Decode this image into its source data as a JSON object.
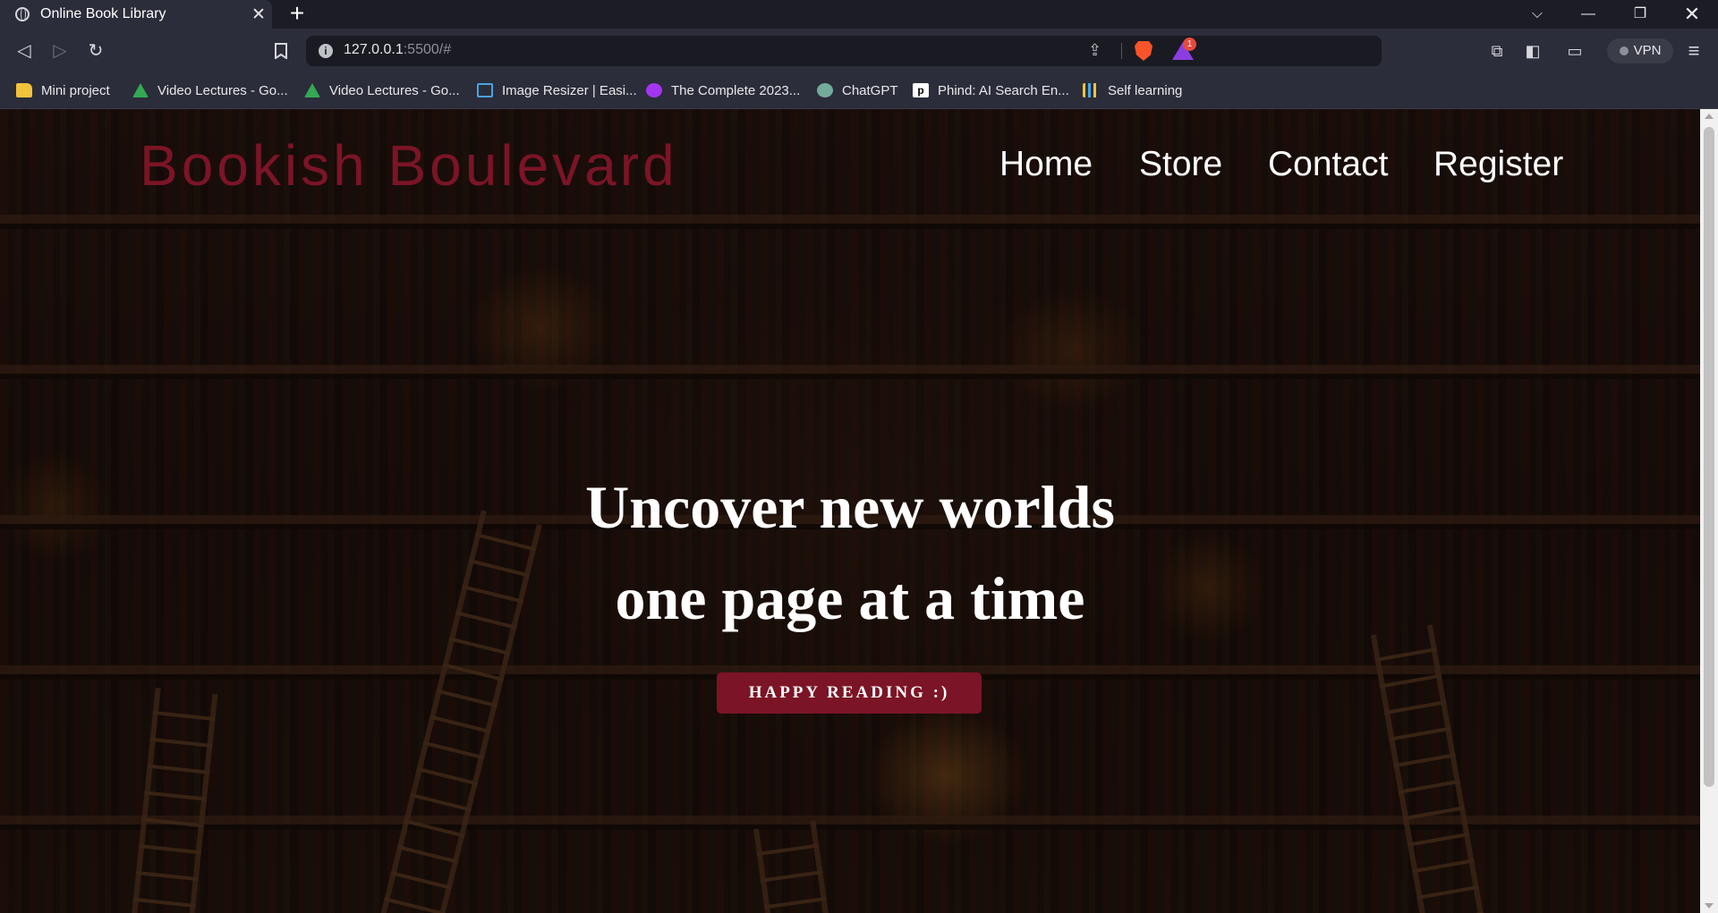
{
  "browser": {
    "tab": {
      "title": "Online Book Library",
      "close_icon": "✕"
    },
    "new_tab_icon": "+",
    "window_controls": {
      "tab_search": "⌵",
      "minimize": "—",
      "maximize": "❐",
      "close": "✕"
    },
    "toolbar": {
      "back_icon": "◁",
      "forward_icon": "▷",
      "reload_icon": "↻",
      "bookmark_icon": "🔖",
      "url_host": "127.0.0.1",
      "url_rest": ":5500/#",
      "share_icon": "⇪",
      "rewards_badge": "1",
      "extensions_icon": "⧉",
      "sidebar_icon": "◧",
      "wallet_icon": "▭",
      "vpn_label": "VPN",
      "menu_icon": "≡"
    },
    "bookmarks": [
      {
        "label": "Mini project",
        "icon": "folder-icon"
      },
      {
        "label": "Video Lectures - Go...",
        "icon": "google-drive-icon"
      },
      {
        "label": "Video Lectures - Go...",
        "icon": "google-drive-icon"
      },
      {
        "label": "Image Resizer | Easi...",
        "icon": "image-resizer-icon"
      },
      {
        "label": "The Complete 2023...",
        "icon": "udemy-icon"
      },
      {
        "label": "ChatGPT",
        "icon": "chatgpt-icon"
      },
      {
        "label": "Phind: AI Search En...",
        "icon": "phind-icon"
      },
      {
        "label": "Self learning",
        "icon": "bars-icon"
      }
    ]
  },
  "site": {
    "logo": "Bookish Boulevard",
    "nav": [
      "Home",
      "Store",
      "Contact",
      "Register"
    ],
    "hero": {
      "line1": "Uncover new worlds",
      "line2": "one page at a time"
    },
    "cta": "HAPPY READING :)",
    "colors": {
      "brand": "#7b1426",
      "text": "#ffffff"
    }
  }
}
